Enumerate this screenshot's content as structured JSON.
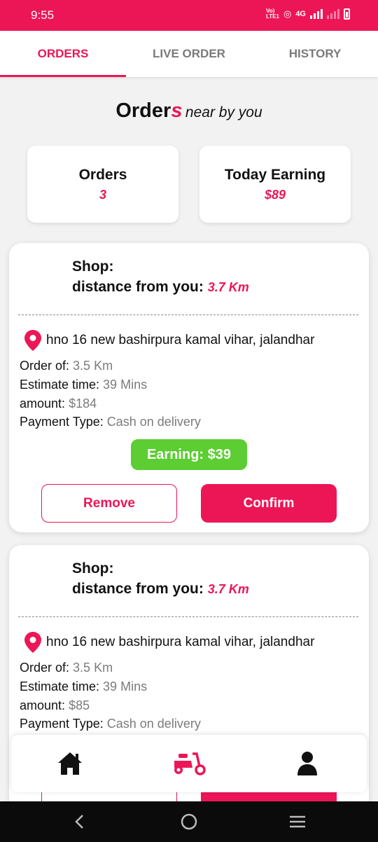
{
  "status": {
    "time": "9:55",
    "carrier": "Vo)) LTE1",
    "network": "4G"
  },
  "tabs": [
    {
      "label": "ORDERS",
      "active": true
    },
    {
      "label": "LIVE ORDER",
      "active": false
    },
    {
      "label": "HISTORY",
      "active": false
    }
  ],
  "heading": {
    "main": "Order",
    "accent": "s",
    "sub": "near by you"
  },
  "stats": {
    "orders_label": "Orders",
    "orders_value": "3",
    "earning_label": "Today Earning",
    "earning_value": "$89"
  },
  "cards": [
    {
      "shop_label": "Shop:",
      "distance_label": "distance from you:",
      "distance_value": "3.7 Km",
      "address": "hno 16 new bashirpura kamal vihar, jalandhar",
      "order_of_label": "Order of:",
      "order_of_value": "3.5 Km",
      "estimate_label": "Estimate time:",
      "estimate_value": "39 Mins",
      "amount_label": "amount:",
      "amount_value": "$184",
      "payment_label": "Payment Type:",
      "payment_value": "Cash on delivery",
      "earning": "Earning: $39",
      "remove_label": "Remove",
      "confirm_label": "Confirm"
    },
    {
      "shop_label": "Shop:",
      "distance_label": "distance from you:",
      "distance_value": "3.7 Km",
      "address": "hno 16 new bashirpura kamal vihar, jalandhar",
      "order_of_label": "Order of:",
      "order_of_value": "3.5 Km",
      "estimate_label": "Estimate time:",
      "estimate_value": "39 Mins",
      "amount_label": "amount:",
      "amount_value": "$85",
      "payment_label": "Payment Type:",
      "payment_value": "Cash on delivery"
    }
  ],
  "bottom_nav": [
    {
      "icon": "home-icon"
    },
    {
      "icon": "scooter-icon",
      "active": true
    },
    {
      "icon": "user-icon"
    }
  ],
  "colors": {
    "accent": "#ec1656",
    "success": "#5ccd32",
    "muted": "#7b7b7b"
  }
}
